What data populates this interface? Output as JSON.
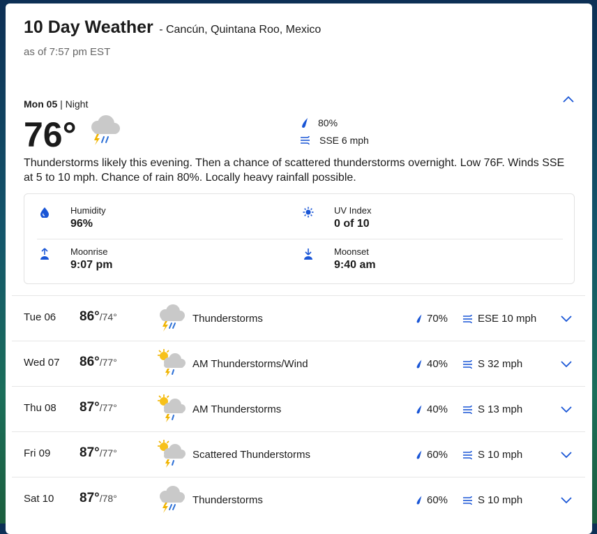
{
  "header": {
    "title": "10 Day Weather",
    "location": "- Cancún, Quintana Roo, Mexico",
    "as_of": "as of 7:57 pm EST"
  },
  "today": {
    "day": "Mon 05",
    "part": "Night",
    "separator": "|",
    "temp": "76°",
    "icon": "thunderstorm-cloud-icon",
    "precip": "80%",
    "wind": "SSE 6 mph",
    "description": "Thunderstorms likely this evening. Then a chance of scattered thunderstorms overnight. Low 76F. Winds SSE at 5 to 10 mph. Chance of rain 80%. Locally heavy rainfall possible.",
    "details": {
      "humidity_label": "Humidity",
      "humidity_value": "96%",
      "uv_label": "UV Index",
      "uv_value": "0 of 10",
      "moonrise_label": "Moonrise",
      "moonrise_value": "9:07 pm",
      "moonset_label": "Moonset",
      "moonset_value": "9:40 am"
    }
  },
  "forecast": [
    {
      "day": "Tue 06",
      "hi": "86°",
      "lo": "/74°",
      "icon": "thunderstorm-icon",
      "condition": "Thunderstorms",
      "precip": "70%",
      "wind": "ESE 10 mph"
    },
    {
      "day": "Wed 07",
      "hi": "86°",
      "lo": "/77°",
      "icon": "sun-thunderstorm-icon",
      "condition": "AM Thunderstorms/Wind",
      "precip": "40%",
      "wind": "S 32 mph"
    },
    {
      "day": "Thu 08",
      "hi": "87°",
      "lo": "/77°",
      "icon": "sun-thunderstorm-icon",
      "condition": "AM Thunderstorms",
      "precip": "40%",
      "wind": "S 13 mph"
    },
    {
      "day": "Fri 09",
      "hi": "87°",
      "lo": "/77°",
      "icon": "sun-thunderstorm-icon",
      "condition": "Scattered Thunderstorms",
      "precip": "60%",
      "wind": "S 10 mph"
    },
    {
      "day": "Sat 10",
      "hi": "87°",
      "lo": "/78°",
      "icon": "thunderstorm-icon",
      "condition": "Thunderstorms",
      "precip": "60%",
      "wind": "S 10 mph"
    }
  ],
  "colors": {
    "accent": "#1a56d6",
    "cloud": "#c7c7c7",
    "bolt": "#f0b400",
    "rain": "#2b6fd6"
  }
}
